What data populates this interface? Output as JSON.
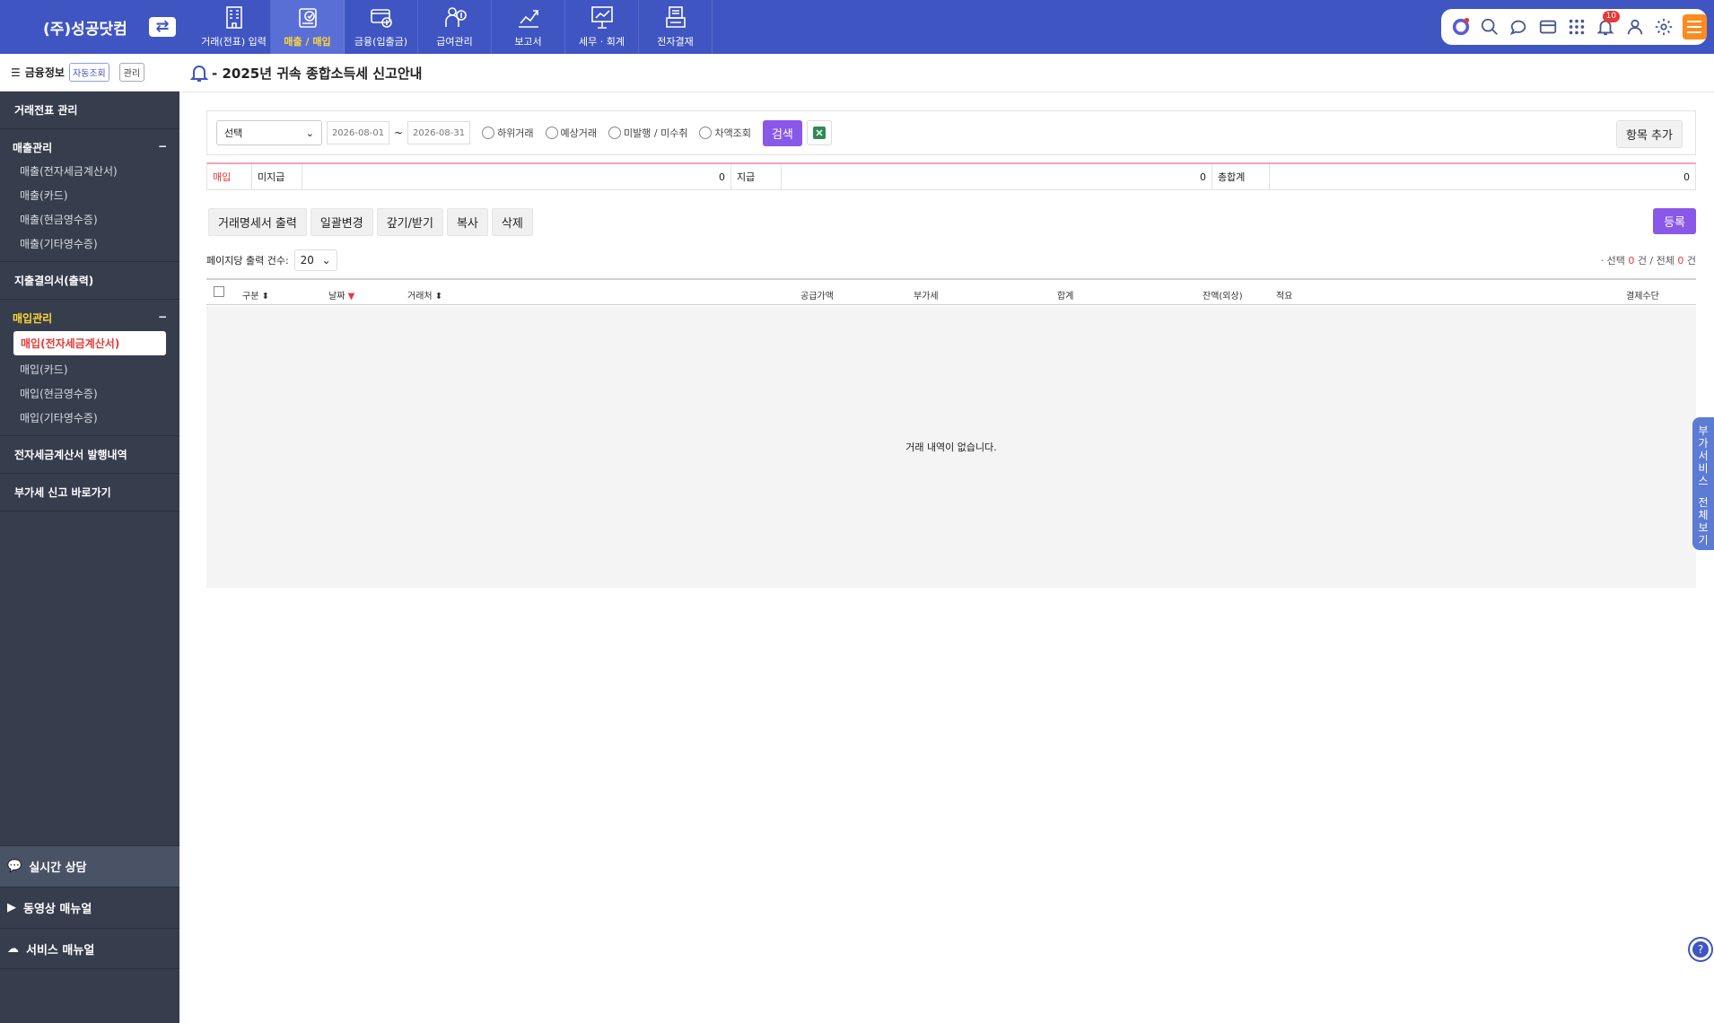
{
  "company": "(주)성공닷컴",
  "menu": [
    {
      "label": "거래(전표) 입력",
      "icon": "building-icon"
    },
    {
      "label": "매출 / 매입",
      "icon": "checklist-icon",
      "active": true
    },
    {
      "label": "금융(입출금)",
      "icon": "card-money-icon"
    },
    {
      "label": "급여관리",
      "icon": "payroll-icon"
    },
    {
      "label": "보고서",
      "icon": "line-chart-icon"
    },
    {
      "label": "세무 · 회계",
      "icon": "presentation-icon"
    },
    {
      "label": "전자결재",
      "icon": "document-stack-icon"
    }
  ],
  "toolbar": {
    "notif_count": "10"
  },
  "sidebar": {
    "header": "금융정보",
    "auto_chip": "자동조회",
    "manage_chip": "관리",
    "voucher": "거래전표 관리",
    "sales_title": "매출관리",
    "sales_items": [
      "매출(전자세금계산서)",
      "매출(카드)",
      "매출(현금영수증)",
      "매출(기타영수증)"
    ],
    "expense": "지출결의서(출력)",
    "purchase_title": "매입관리",
    "purchase_items": [
      "매입(전자세금계산서)",
      "매입(카드)",
      "매입(현금영수증)",
      "매입(기타영수증)"
    ],
    "etax": "전자세금계산서 발행내역",
    "vat": "부가세 신고 바로가기",
    "consult": "실시간 상담",
    "video": "동영상 매뉴얼",
    "service": "서비스 매뉴얼"
  },
  "notice": "- 2025년 귀속 종합소득세 신고안내",
  "search": {
    "select": "선택",
    "date_from": "2026-08-01",
    "tilde": "~",
    "date_to": "2026-08-31",
    "radios": [
      "하위거래",
      "예상거래",
      "미발행 / 미수취",
      "차액조회"
    ],
    "search_btn": "검색",
    "add_item": "항목 추가"
  },
  "summary": {
    "type": "매입",
    "unpaid_label": "미지급",
    "unpaid": "0",
    "paid_label": "지급",
    "paid": "0",
    "total_label": "총합계",
    "total": "0"
  },
  "actions": [
    "거래명세서 출력",
    "일괄변경",
    "갚기/받기",
    "복사",
    "삭제"
  ],
  "register": "등록",
  "perpage": {
    "label": "페이지당 출력 건수:",
    "value": "20"
  },
  "count": {
    "prefix": "· 선택",
    "selected": "0",
    "mid": "건 / 전체",
    "total": "0",
    "suffix": "건"
  },
  "columns": [
    "구분",
    "날짜",
    "거래처",
    "공급가액",
    "부가세",
    "합계",
    "잔액(외상)",
    "적요",
    "결제수단"
  ],
  "empty": "거래 내역이 없습니다.",
  "side_tab": [
    "부",
    "가",
    "서",
    "비",
    "스",
    "",
    "전",
    "체",
    "보",
    "기"
  ],
  "colors": {
    "brand": "#3f55c2",
    "accent": "#8a58e8",
    "sidebar": "#363d4d",
    "highlight": "#ffd733"
  }
}
